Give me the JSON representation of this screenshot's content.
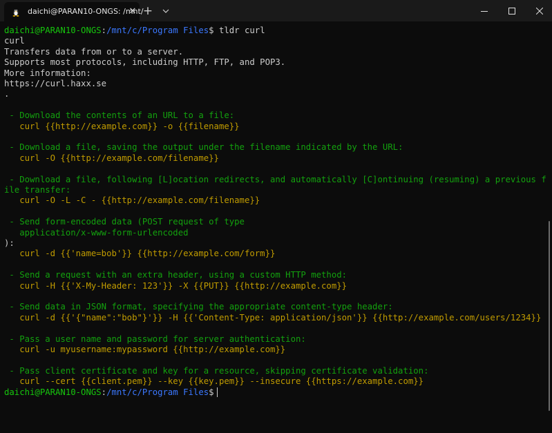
{
  "window": {
    "tab_title": "daichi@PARAN10-ONGS: /mnt/",
    "tab_close": "✕",
    "new_tab": "+",
    "dropdown": "⌵"
  },
  "terminal": {
    "line1_user": "daichi@PARAN10-ONGS",
    "line1_colon": ":",
    "line1_path": "/mnt/c/Program Files",
    "line1_cmd": "$ tldr curl",
    "line2": "curl",
    "line3": "Transfers data from or to a server.",
    "line4": "Supports most protocols, including HTTP, FTP, and POP3.",
    "line5": "More information:",
    "line6": "https://curl.haxx.se",
    "line7": ".",
    "ex1_desc": " - Download the contents of an URL to a file:",
    "ex1_cmd": "   curl {{http://example.com}} -o {{filename}}",
    "ex2_desc": " - Download a file, saving the output under the filename indicated by the URL:",
    "ex2_cmd": "   curl -O {{http://example.com/filename}}",
    "ex3_desc_a": " - Download a file, following [L]ocation redirects, and automatically [C]ontinuing (resuming) a previous f",
    "ex3_desc_b": "ile transfer:",
    "ex3_cmd": "   curl -O -L -C - {{http://example.com/filename}}",
    "ex4_desc_a": " - Send form-encoded data (POST request of type",
    "ex4_desc_b": "   application/x-www-form-urlencoded",
    "ex4_desc_c": "):",
    "ex4_cmd": "   curl -d {{'name=bob'}} {{http://example.com/form}}",
    "ex5_desc": " - Send a request with an extra header, using a custom HTTP method:",
    "ex5_cmd": "   curl -H {{'X-My-Header: 123'}} -X {{PUT}} {{http://example.com}}",
    "ex6_desc": " - Send data in JSON format, specifying the appropriate content-type header:",
    "ex6_cmd": "   curl -d {{'{\"name\":\"bob\"}'}} -H {{'Content-Type: application/json'}} {{http://example.com/users/1234}}",
    "ex7_desc": " - Pass a user name and password for server authentication:",
    "ex7_cmd": "   curl -u myusername:mypassword {{http://example.com}}",
    "ex8_desc": " - Pass client certificate and key for a resource, skipping certificate validation:",
    "ex8_cmd": "   curl --cert {{client.pem}} --key {{key.pem}} --insecure {{https://example.com}}",
    "prompt_user": "daichi@PARAN10-ONGS",
    "prompt_colon": ":",
    "prompt_path": "/mnt/c/Program Files",
    "prompt_dollar": "$"
  },
  "icons": {
    "tab": "linux-penguin-icon",
    "minimize": "minimize-icon",
    "maximize": "maximize-icon",
    "close": "close-icon"
  },
  "colors": {
    "background": "#0c0c0c",
    "titlebar": "#1a1a1a",
    "prompt_user": "#16c60c",
    "prompt_path": "#3b78ff",
    "description": "#13a10e",
    "command": "#c19c00",
    "text": "#cccccc"
  }
}
